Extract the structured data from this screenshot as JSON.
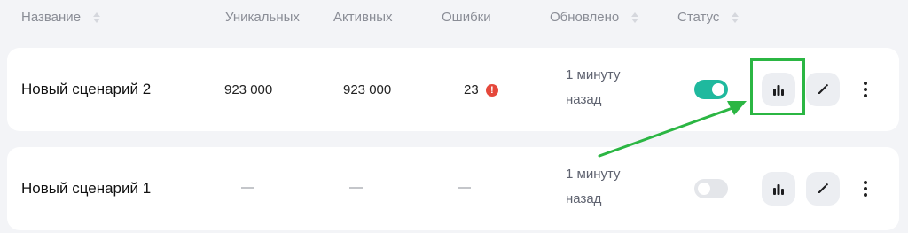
{
  "header": {
    "name": "Название",
    "unique": "Уникальных",
    "active": "Активных",
    "errors": "Ошибки",
    "updated": "Обновлено",
    "status": "Статус"
  },
  "rows": [
    {
      "name": "Новый сценарий 2",
      "unique": "923 000",
      "active": "923 000",
      "errors": "23",
      "error_badge": "!",
      "updated_line1": "1 минуту",
      "updated_line2": "назад",
      "status_on": true
    },
    {
      "name": "Новый сценарий 1",
      "unique": "—",
      "active": "—",
      "errors": "—",
      "updated_line1": "1 минуту",
      "updated_line2": "назад",
      "status_on": false
    }
  ],
  "icons": {
    "stats": "bar-chart-icon",
    "edit": "pencil-icon",
    "more": "kebab-menu-icon"
  },
  "colors": {
    "toggle_on": "#1fb99e",
    "error": "#e5483b",
    "annotation": "#2bb643"
  }
}
